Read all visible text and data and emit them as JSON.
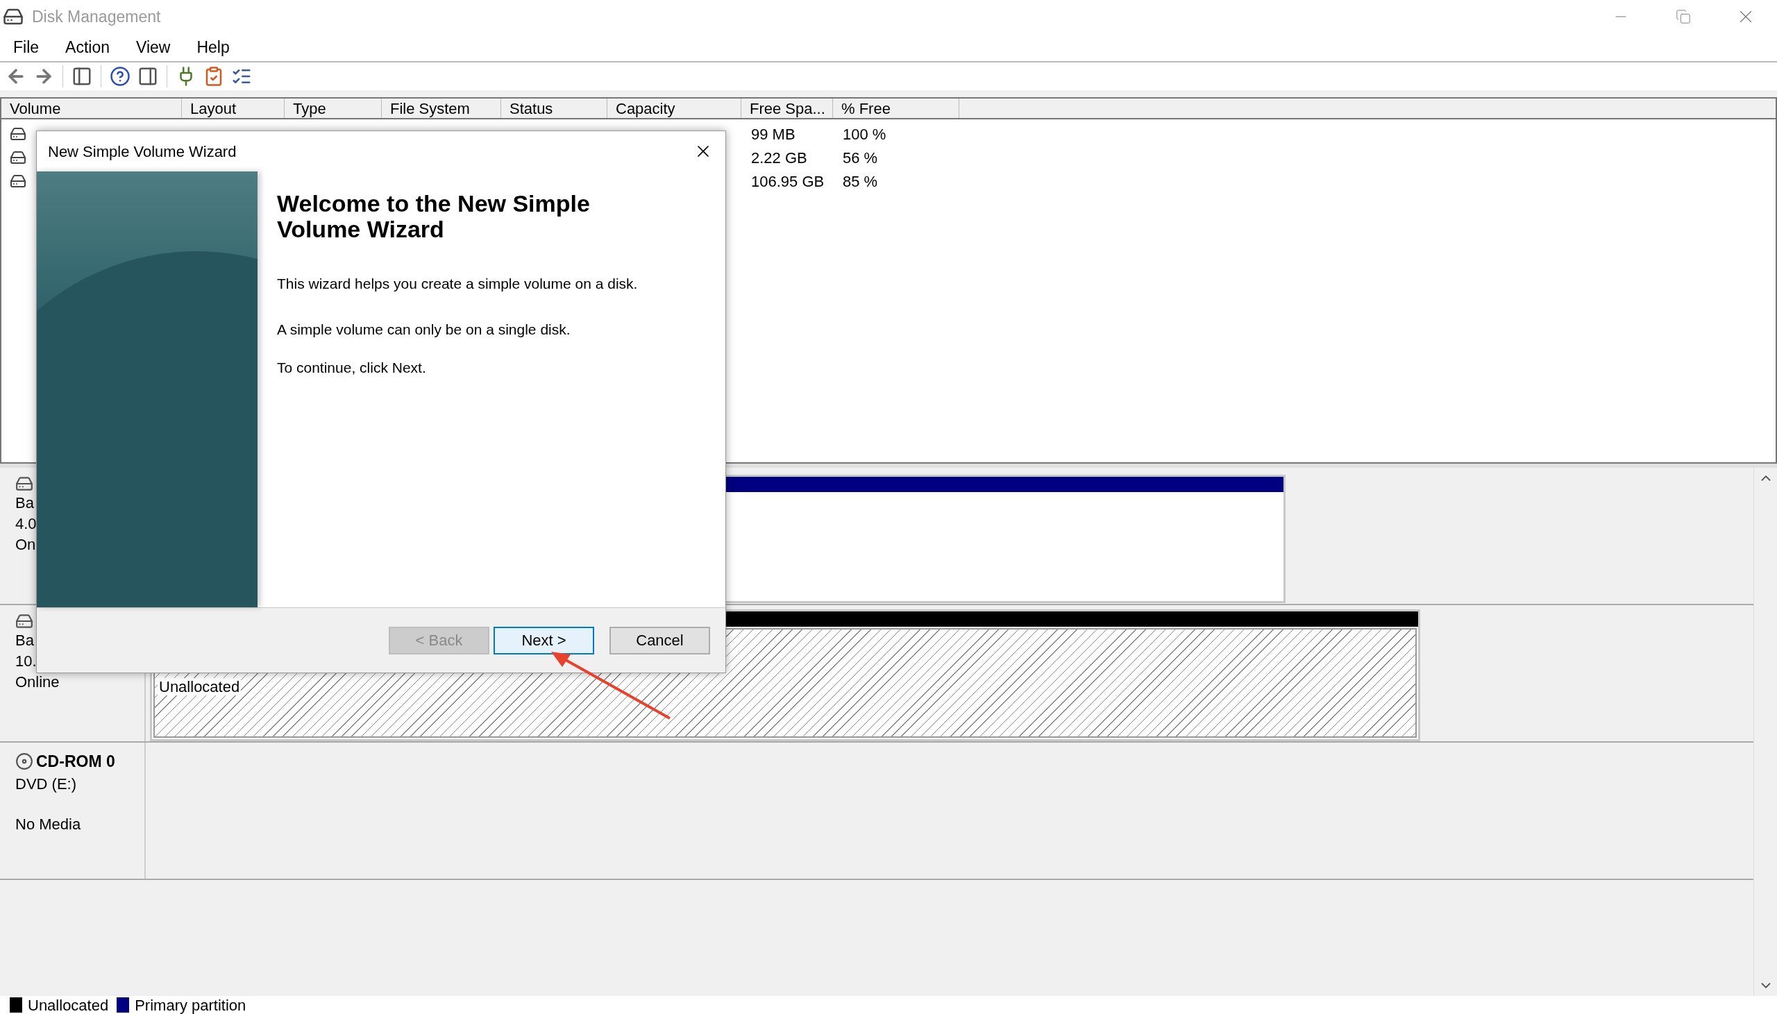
{
  "window": {
    "title": "Disk Management"
  },
  "menu": [
    "File",
    "Action",
    "View",
    "Help"
  ],
  "table": {
    "columns": [
      "Volume",
      "Layout",
      "Type",
      "File System",
      "Status",
      "Capacity",
      "Free Spa...",
      "% Free"
    ],
    "rows": [
      {
        "free_space": "99 MB",
        "percent_free": "100 %"
      },
      {
        "free_space": "2.22 GB",
        "percent_free": "56 %"
      },
      {
        "free_space": "106.95 GB",
        "percent_free": "85 %"
      }
    ]
  },
  "disks": [
    {
      "kind": "basic",
      "lines": [
        "Ba",
        "4.0",
        "On"
      ],
      "partition": {
        "kind": "primary"
      }
    },
    {
      "kind": "basic",
      "lines": [
        "Ba",
        "10.",
        "Online"
      ],
      "partition": {
        "kind": "unallocated",
        "label": "Unallocated"
      }
    },
    {
      "kind": "cdrom",
      "name": "CD-ROM 0",
      "lines": [
        "DVD (E:)",
        "No Media"
      ]
    }
  ],
  "legend": [
    {
      "label": "Unallocated",
      "color": "#000000"
    },
    {
      "label": "Primary partition",
      "color": "#000080"
    }
  ],
  "wizard": {
    "title": "New Simple Volume Wizard",
    "heading": "Welcome to the New Simple Volume Wizard",
    "paragraphs": [
      "This wizard helps you create a simple volume on a disk.",
      "A simple volume can only be on a single disk.",
      "To continue, click Next."
    ],
    "buttons": [
      {
        "label": "< Back",
        "disabled": true,
        "default": false
      },
      {
        "label": "Next >",
        "disabled": false,
        "default": true
      },
      {
        "label": "Cancel",
        "disabled": false,
        "default": false
      }
    ]
  }
}
